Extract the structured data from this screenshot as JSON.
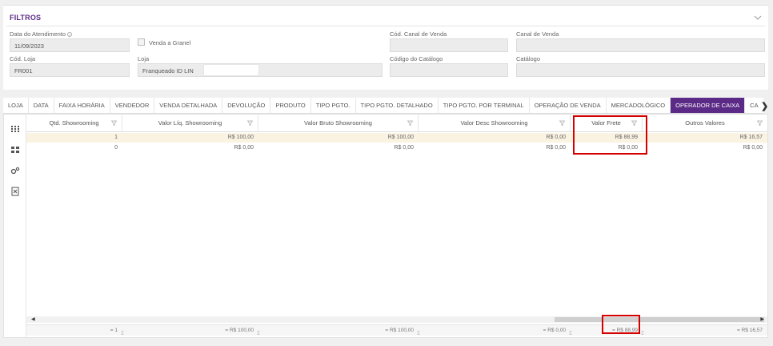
{
  "filters": {
    "title": "FILTROS",
    "data_atendimento_label": "Data do Atendimento",
    "data_atendimento_value": "11/09/2023",
    "venda_granel_label": "Venda a Granel",
    "cod_canal_label": "Cód. Canal de Venda",
    "canal_label": "Canal de Venda",
    "cod_loja_label": "Cód. Loja",
    "cod_loja_value": "FR001",
    "loja_label": "Loja",
    "loja_value": "Franqueado ID LIN",
    "cod_catalogo_label": "Código do Catálogo",
    "catalogo_label": "Catálogo"
  },
  "tabs": [
    "LOJA",
    "DATA",
    "FAIXA HORÁRIA",
    "VENDEDOR",
    "VENDA DETALHADA",
    "DEVOLUÇÃO",
    "PRODUTO",
    "TIPO PGTO.",
    "TIPO PGTO. DETALHADO",
    "TIPO PGTO. POR TERMINAL",
    "OPERAÇÃO DE VENDA",
    "MERCADOLÓGICO",
    "OPERADOR DE CAIXA",
    "CA"
  ],
  "active_tab": "OPERADOR DE CAIXA",
  "grid": {
    "columns": [
      "Qtd. Showrooming",
      "Valor Líq. Showrooming",
      "Valor Bruto Showrooming",
      "Valor Desc Showrooming",
      "Valor Frete",
      "Outros Valores"
    ],
    "rows": [
      [
        "1",
        "R$ 100,00",
        "R$ 100,00",
        "R$ 0,00",
        "R$ 88,99",
        "R$ 16,57"
      ],
      [
        "0",
        "R$ 0,00",
        "R$ 0,00",
        "R$ 0,00",
        "R$ 0,00",
        "R$ 0,00"
      ]
    ],
    "footer": [
      "= 1",
      "= R$ 100,00",
      "= R$ 100,00",
      "= R$ 0,00",
      "= R$ 88,99",
      "= R$ 16,57"
    ]
  },
  "icons": {
    "grid_tool_1": "columns-icon",
    "grid_tool_2": "grid-icon",
    "grid_tool_3": "settings-icon",
    "grid_tool_4": "excel-export-icon"
  },
  "colors": {
    "accent": "#5b2a86",
    "highlight_row": "#fbf3e2",
    "annotation_red": "#d40000"
  }
}
